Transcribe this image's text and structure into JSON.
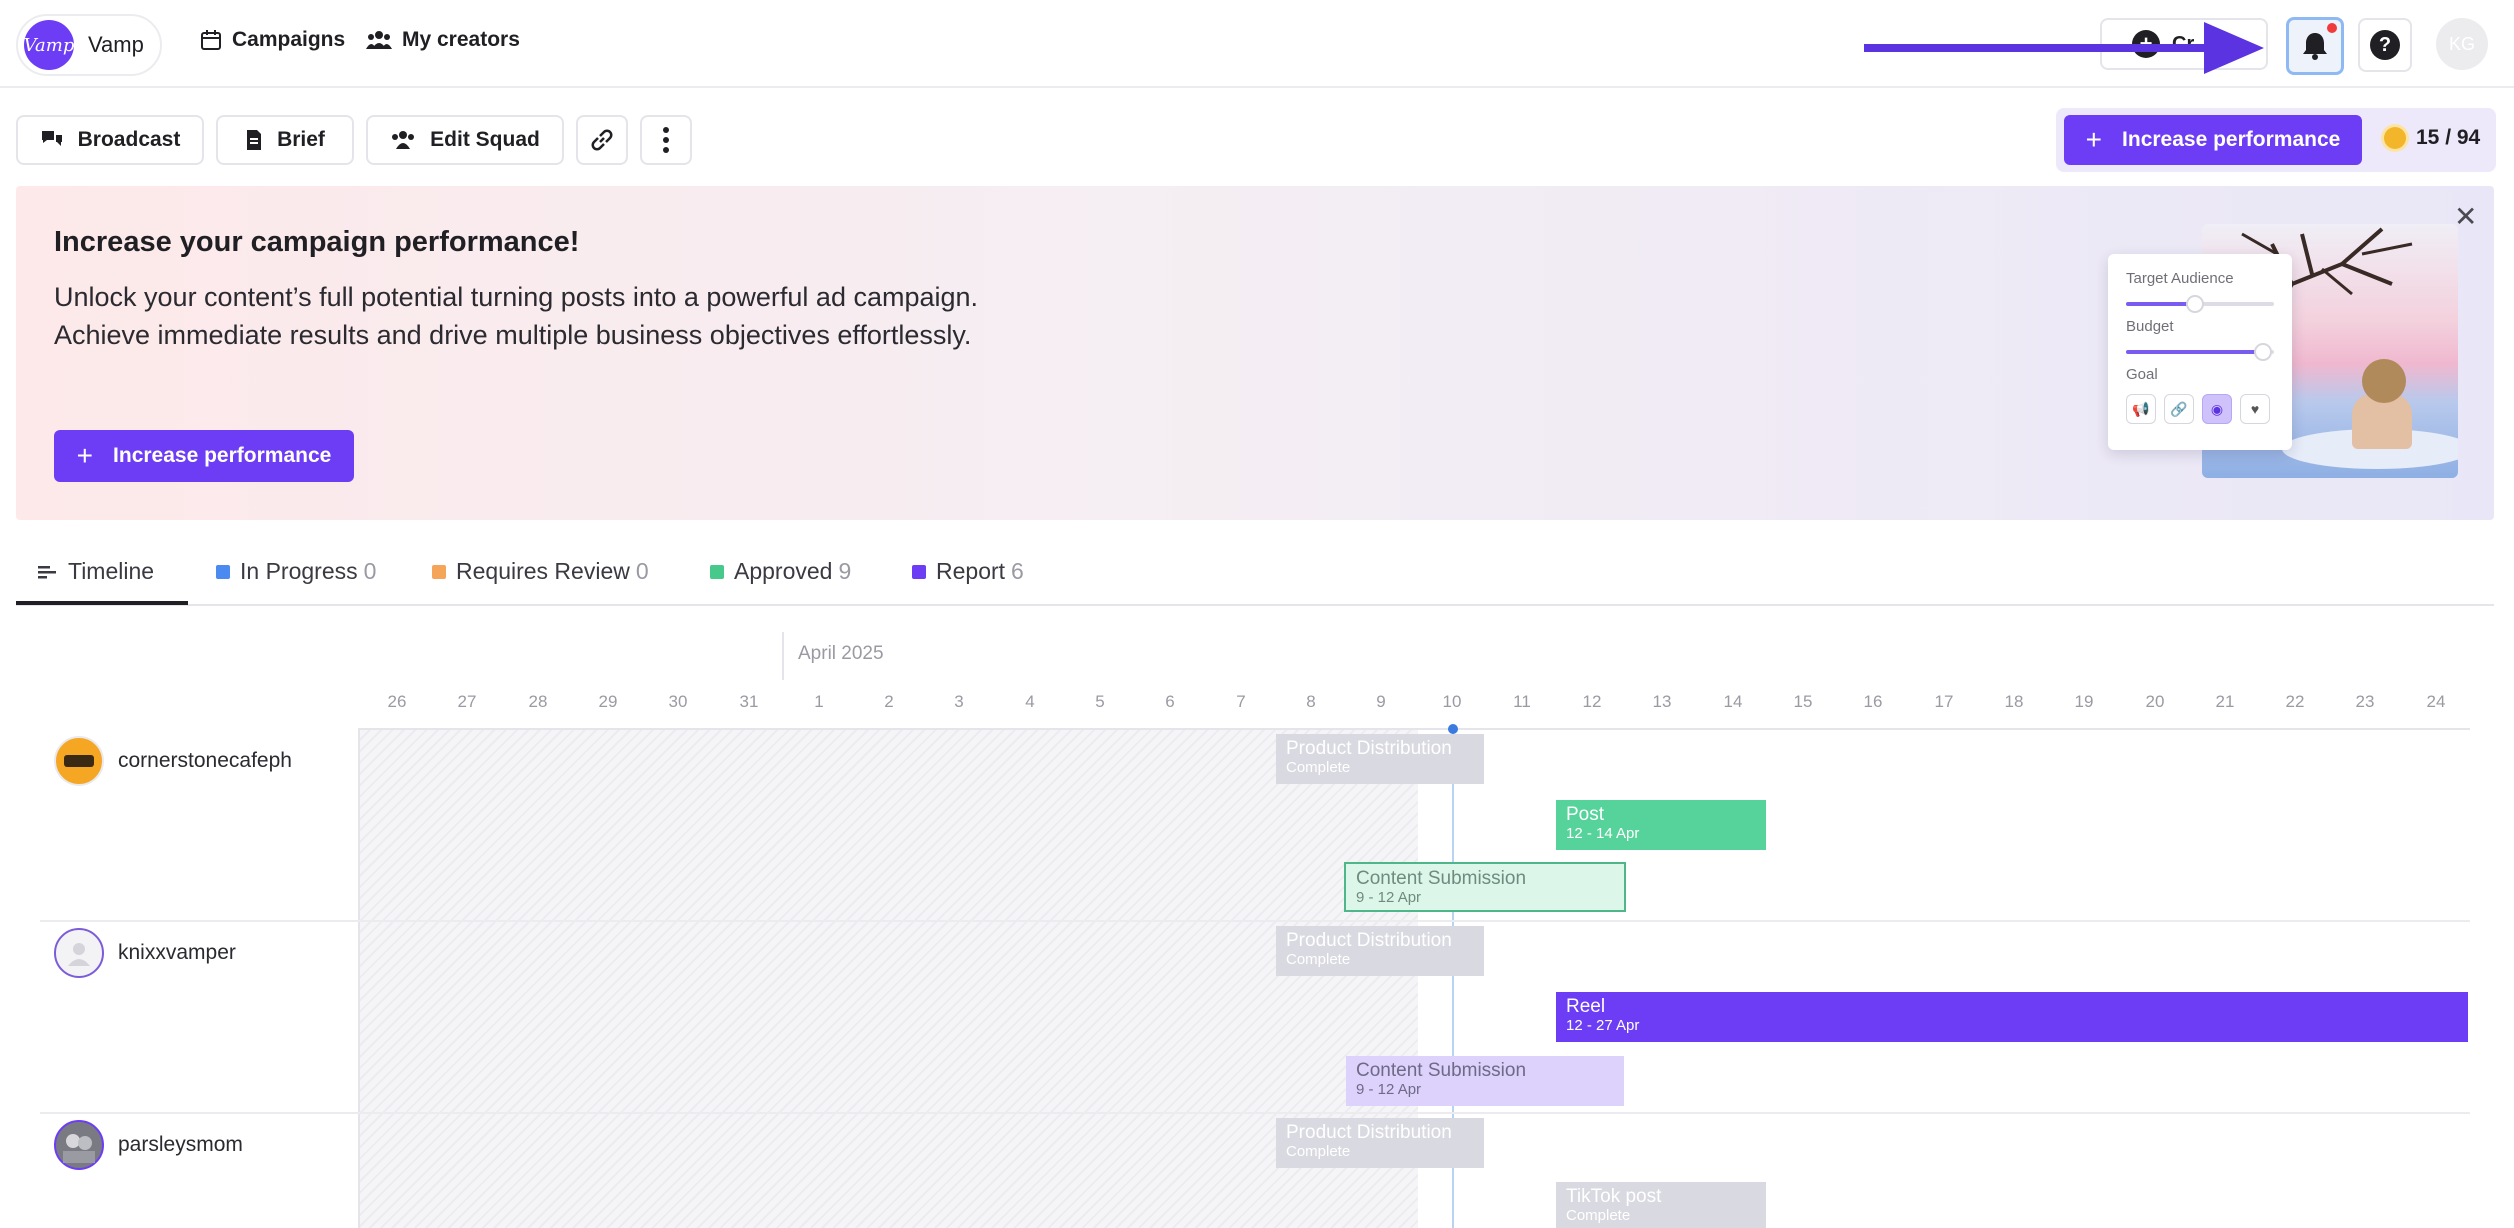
{
  "brand": {
    "logo_text": "Vamp",
    "name": "Vamp"
  },
  "nav": [
    {
      "label": "Campaigns",
      "icon": "calendar-icon"
    },
    {
      "label": "My creators",
      "icon": "people-icon"
    }
  ],
  "header_right": {
    "create_label": "Cr",
    "user_initials": "KG",
    "notification_dot_color": "#ef3b3b"
  },
  "toolbar": {
    "broadcast": "Broadcast",
    "brief": "Brief",
    "edit_squad": "Edit Squad",
    "increase_performance": "Increase performance",
    "score": "15 / 94"
  },
  "banner": {
    "title": "Increase your campaign performance!",
    "line1": "Unlock your content’s full potential turning posts into a powerful ad campaign.",
    "line2": "Achieve immediate results and drive multiple business objectives effortlessly.",
    "button": "Increase performance",
    "card": {
      "target_audience": "Target Audience",
      "target_audience_level": 0.45,
      "budget": "Budget",
      "budget_level": 0.9,
      "goal": "Goal"
    }
  },
  "tabs": [
    {
      "label": "Timeline",
      "count": ""
    },
    {
      "label": "In Progress",
      "count": "0",
      "color": "#4b8af0"
    },
    {
      "label": "Requires Review",
      "count": "0",
      "color": "#f5a55a"
    },
    {
      "label": "Approved",
      "count": "9",
      "color": "#46c98a"
    },
    {
      "label": "Report",
      "count": "6",
      "color": "#6d3df5"
    }
  ],
  "timeline": {
    "month": "April 2025",
    "days": [
      "26",
      "27",
      "28",
      "29",
      "30",
      "31",
      "1",
      "2",
      "3",
      "4",
      "5",
      "6",
      "7",
      "8",
      "9",
      "10",
      "11",
      "12",
      "13",
      "14",
      "15",
      "16",
      "17",
      "18",
      "19",
      "20",
      "21",
      "22",
      "23",
      "24"
    ],
    "creators": [
      {
        "name": "cornerstonecafeph",
        "tasks": [
          {
            "title": "Product Distribution",
            "sub": "Complete"
          },
          {
            "title": "Post",
            "sub": "12 - 14 Apr"
          },
          {
            "title": "Content Submission",
            "sub": "9 - 12 Apr"
          }
        ]
      },
      {
        "name": "knixxvamper",
        "tasks": [
          {
            "title": "Product Distribution",
            "sub": "Complete"
          },
          {
            "title": "Reel",
            "sub": "12 - 27 Apr"
          },
          {
            "title": "Content Submission",
            "sub": "9 - 12 Apr"
          }
        ]
      },
      {
        "name": "parsleysmom",
        "tasks": [
          {
            "title": "Product Distribution",
            "sub": "Complete"
          },
          {
            "title": "TikTok post",
            "sub": "Complete"
          }
        ]
      }
    ]
  }
}
